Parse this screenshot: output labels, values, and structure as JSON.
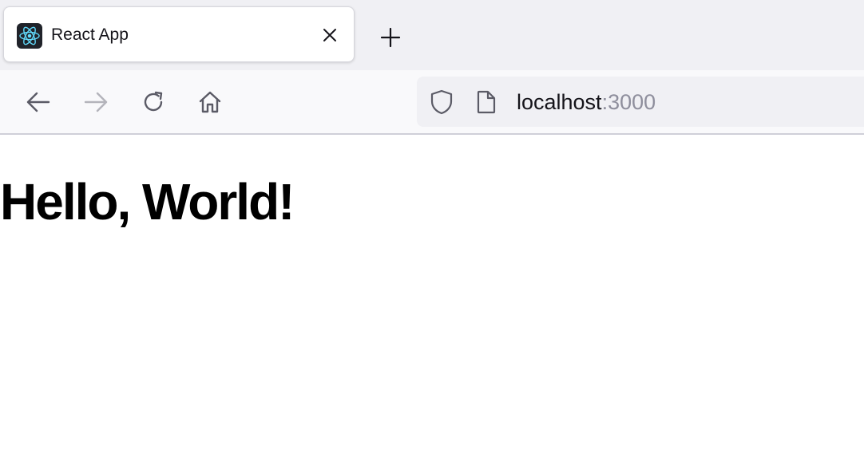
{
  "browser": {
    "tab": {
      "title": "React App",
      "favicon": "react-logo-icon",
      "close_icon": "close-icon"
    },
    "new_tab_icon": "plus-icon",
    "nav": {
      "back_icon": "arrow-left-icon",
      "forward_icon": "arrow-right-icon",
      "reload_icon": "reload-icon",
      "home_icon": "home-icon"
    },
    "url": {
      "security_icon": "shield-icon",
      "page_icon": "page-icon",
      "host": "localhost",
      "port": ":3000"
    }
  },
  "page": {
    "heading": "Hello, World!"
  },
  "colors": {
    "tabbar_bg": "#f0f0f4",
    "navbar_bg": "#f9f9fb",
    "favicon_bg": "#20232a",
    "react_blue": "#61dafb",
    "port_gray": "#8f8f9d"
  }
}
